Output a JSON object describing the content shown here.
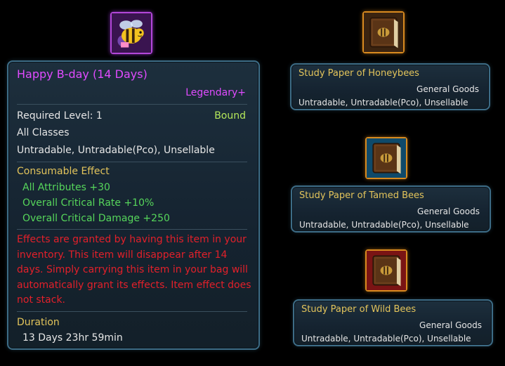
{
  "main_item": {
    "icon": "bee-icon",
    "title": "Happy B-day (14 Days)",
    "grade": "Legendary+",
    "required_level": "Required Level: 1",
    "bound": "Bound",
    "classes": "All Classes",
    "trade": "Untradable, Untradable(Pco), Unsellable",
    "effect_header": "Consumable Effect",
    "effects": [
      "All Attributes +30",
      "Overall Critical Rate +10%",
      "Overall Critical Damage +250"
    ],
    "description": "Effects are granted by having this item in your inventory. This item will disappear after 14 days. Simply carrying this item in your bag will automatically grant its effects. Item effect does not stack.",
    "duration_header": "Duration",
    "duration": "13 Days 23hr 59min"
  },
  "study_papers": [
    {
      "icon": "book-icon",
      "name": "Study Paper of Honeybees",
      "category": "General Goods",
      "trade": "Untradable, Untradable(Pco), Unsellable"
    },
    {
      "icon": "book-icon",
      "name": "Study Paper of Tamed Bees",
      "category": "General Goods",
      "trade": "Untradable, Untradable(Pco), Unsellable"
    },
    {
      "icon": "book-icon",
      "name": "Study Paper of Wild Bees",
      "category": "General Goods",
      "trade": "Untradable, Untradable(Pco), Unsellable"
    }
  ],
  "colors": {
    "legendary": "#e04bff",
    "bound": "#b5e85a",
    "section_header": "#e3c45b",
    "effect": "#56d65b",
    "warning": "#e2202a",
    "card_border": "#3d6c86",
    "icon_border_orange": "#d88a1f",
    "icon_border_purple": "#b347d9"
  }
}
